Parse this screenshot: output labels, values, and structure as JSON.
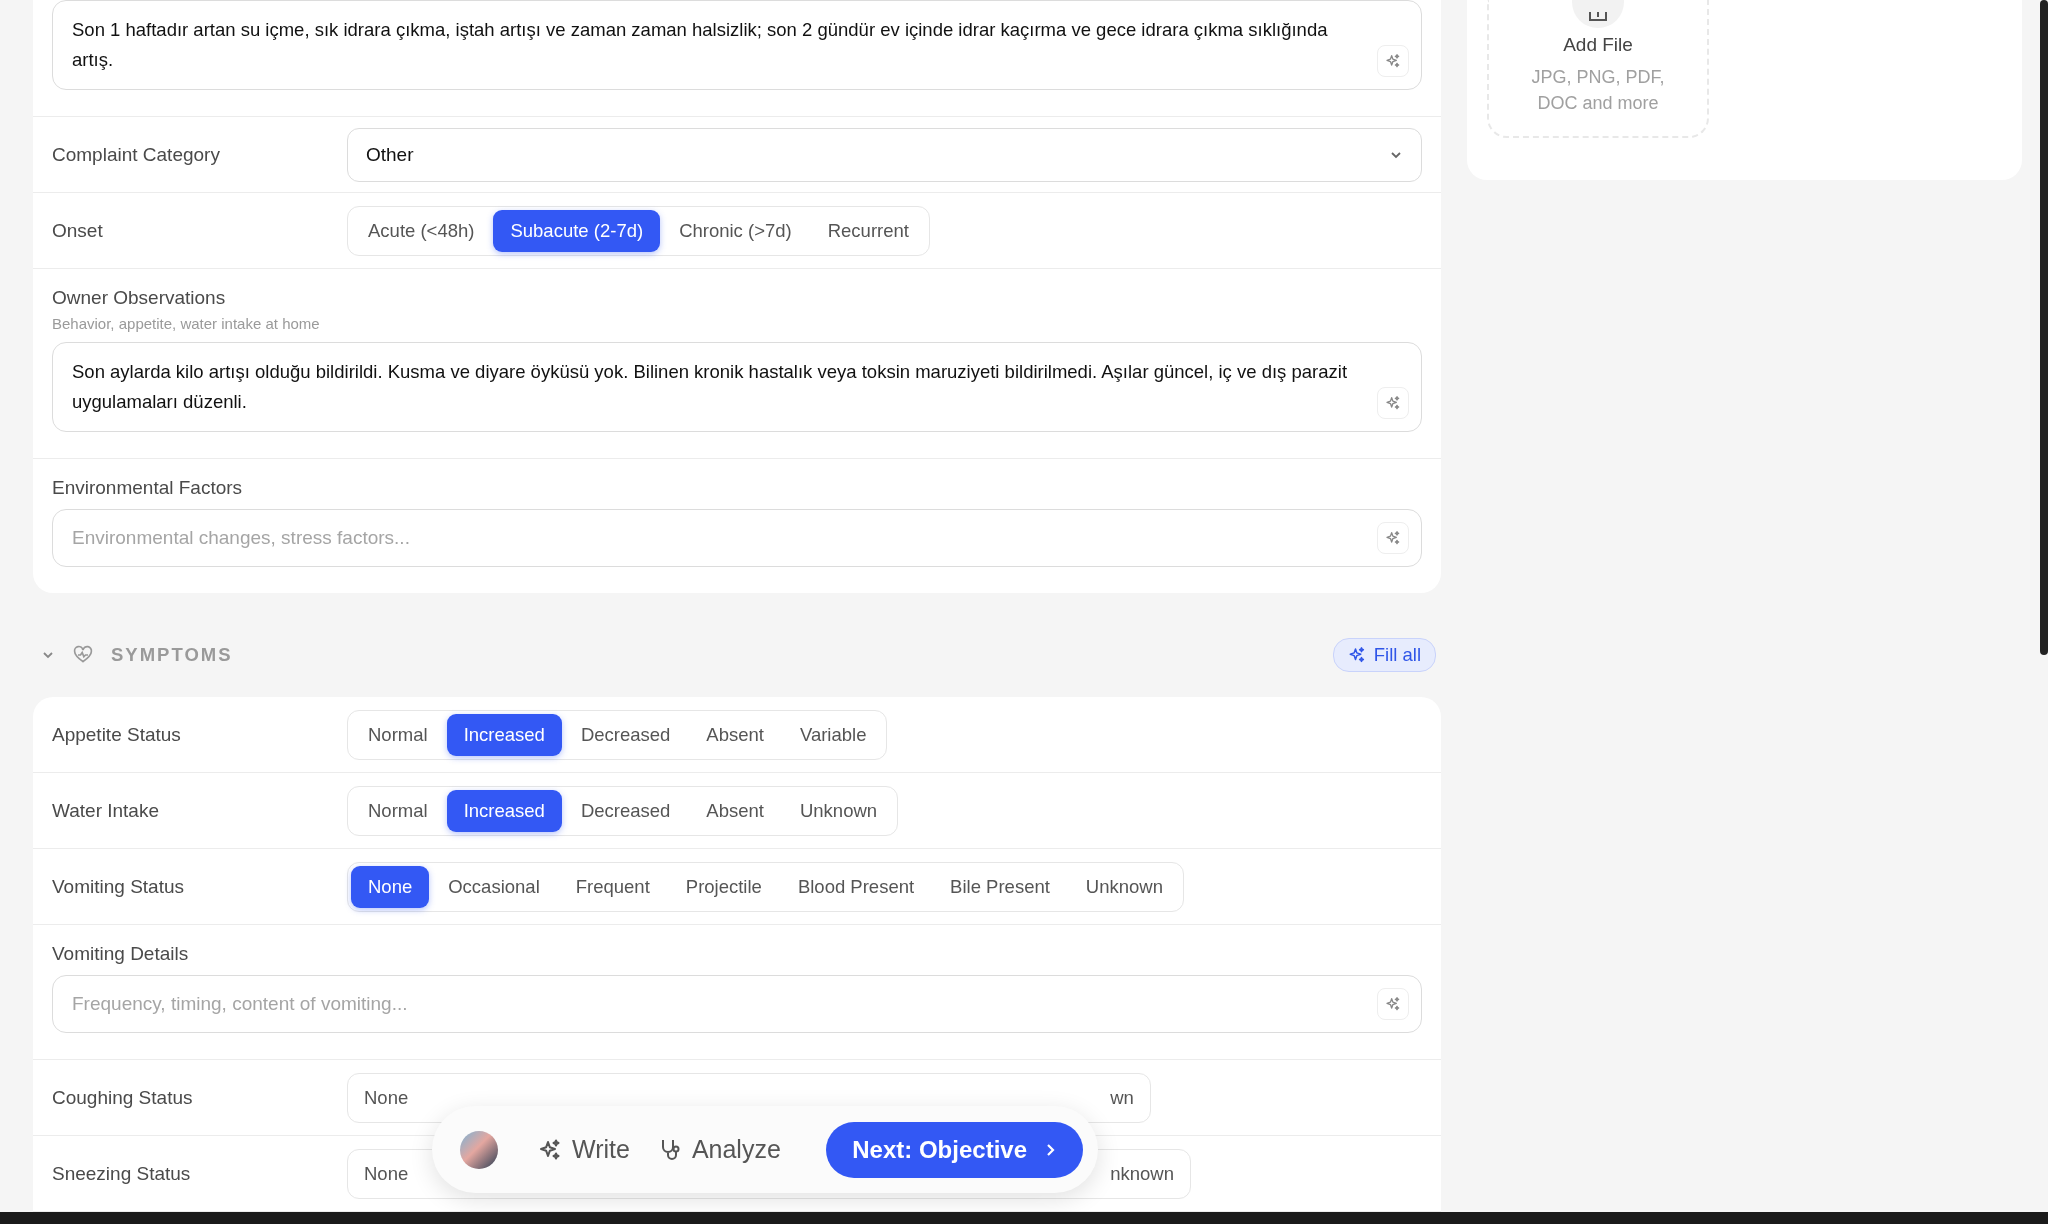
{
  "chief_complaint": {
    "value": "Son 1 haftadır artan su içme, sık idrara çıkma, iştah artışı ve zaman zaman halsizlik; son 2 gündür ev içinde idrar kaçırma ve gece idrara çıkma sıklığında artış."
  },
  "complaint_category": {
    "label": "Complaint Category",
    "value": "Other"
  },
  "onset": {
    "label": "Onset",
    "options": [
      {
        "label": "Acute (<48h)",
        "selected": false
      },
      {
        "label": "Subacute (2-7d)",
        "selected": true
      },
      {
        "label": "Chronic (>7d)",
        "selected": false
      },
      {
        "label": "Recurrent",
        "selected": false
      }
    ]
  },
  "owner_observations": {
    "label": "Owner Observations",
    "hint": "Behavior, appetite, water intake at home",
    "value": "Son aylarda kilo artışı olduğu bildirildi. Kusma ve diyare öyküsü yok. Bilinen kronik hastalık veya toksin maruziyeti bildirilmedi. Aşılar güncel, iç ve dış parazit uygulamaları düzenli."
  },
  "environmental_factors": {
    "label": "Environmental Factors",
    "placeholder": "Environmental changes, stress factors..."
  },
  "symptoms": {
    "title": "SYMPTOMS",
    "expanded": true,
    "fill_all": "Fill all",
    "rows": [
      {
        "kind": "choice",
        "label": "Appetite Status",
        "options": [
          {
            "label": "Normal",
            "selected": false
          },
          {
            "label": "Increased",
            "selected": true
          },
          {
            "label": "Decreased",
            "selected": false
          },
          {
            "label": "Absent",
            "selected": false
          },
          {
            "label": "Variable",
            "selected": false
          }
        ]
      },
      {
        "kind": "choice",
        "label": "Water Intake",
        "options": [
          {
            "label": "Normal",
            "selected": false
          },
          {
            "label": "Increased",
            "selected": true
          },
          {
            "label": "Decreased",
            "selected": false
          },
          {
            "label": "Absent",
            "selected": false
          },
          {
            "label": "Unknown",
            "selected": false
          }
        ]
      },
      {
        "kind": "choice",
        "label": "Vomiting Status",
        "options": [
          {
            "label": "None",
            "selected": true
          },
          {
            "label": "Occasional",
            "selected": false
          },
          {
            "label": "Frequent",
            "selected": false
          },
          {
            "label": "Projectile",
            "selected": false
          },
          {
            "label": "Blood Present",
            "selected": false
          },
          {
            "label": "Bile Present",
            "selected": false
          },
          {
            "label": "Unknown",
            "selected": false
          }
        ]
      },
      {
        "kind": "text",
        "label": "Vomiting Details",
        "placeholder": "Frequency, timing, content of vomiting..."
      },
      {
        "kind": "choice",
        "label": "Coughing Status",
        "covered": true,
        "options": [
          {
            "label": "None",
            "selected": false
          },
          {
            "label": "wn",
            "selected": false
          }
        ]
      },
      {
        "kind": "choice",
        "label": "Sneezing Status",
        "covered": true,
        "options": [
          {
            "label": "None",
            "selected": false
          },
          {
            "label": "nknown",
            "selected": false
          }
        ]
      }
    ]
  },
  "upload": {
    "title": "Add File",
    "hint": "JPG, PNG, PDF, DOC and more"
  },
  "action_bar": {
    "write": "Write",
    "analyze": "Analyze",
    "next": "Next: Objective"
  }
}
